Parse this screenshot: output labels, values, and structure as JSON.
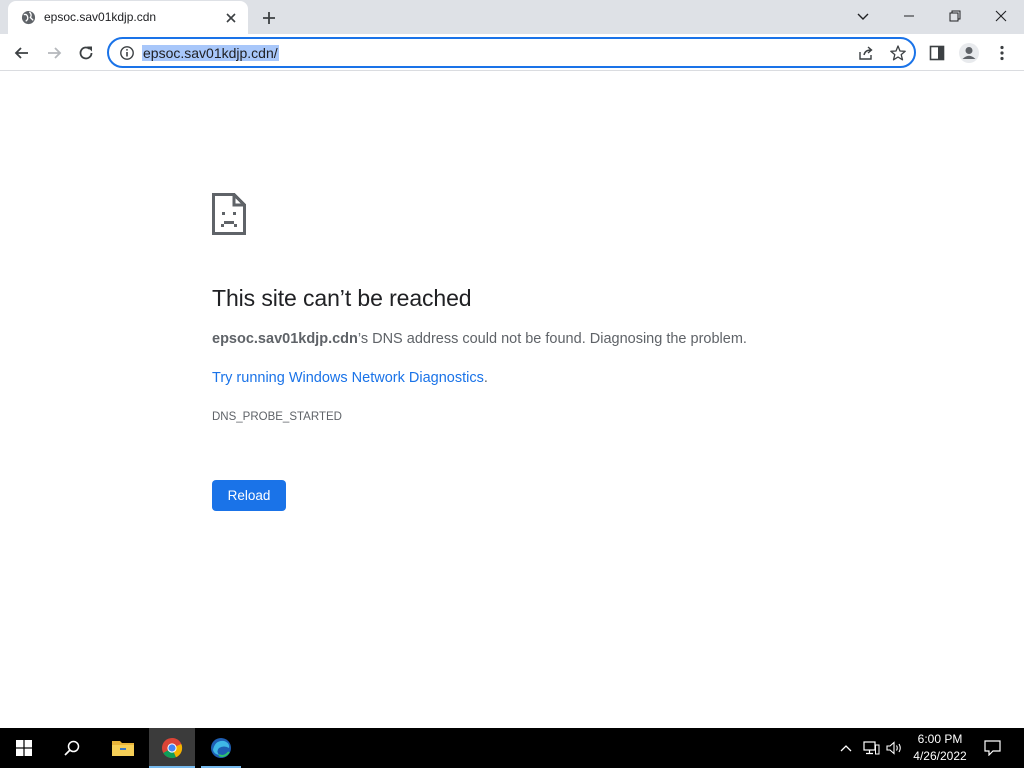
{
  "browser": {
    "tab": {
      "title": "epsoc.sav01kdjp.cdn",
      "favicon": "globe-icon"
    },
    "new_tab_icon": "plus-icon",
    "window_controls": [
      "chevron-down-icon",
      "minimize-icon",
      "restore-icon",
      "close-icon"
    ],
    "address_bar": {
      "url": "epsoc.sav01kdjp.cdn/",
      "url_selected": true,
      "accent": "#1a73e8",
      "selection_color": "#a8c7fa"
    }
  },
  "error_page": {
    "heading": "This site can’t be reached",
    "host": "epsoc.sav01kdjp.cdn",
    "message_suffix": "’s DNS address could not be found. Diagnosing the problem.",
    "link_text": "Try running Windows Network Diagnostics",
    "link_suffix": ".",
    "error_code": "DNS_PROBE_STARTED",
    "reload_label": "Reload",
    "button_color": "#1a73e8"
  },
  "taskbar": {
    "apps": [
      "windows-start-icon",
      "search-icon",
      "file-explorer-icon",
      "chrome-icon",
      "edge-icon"
    ],
    "active_app": "chrome-icon",
    "tray_icons": [
      "chevron-up-icon",
      "network-icon",
      "volume-icon",
      "notification-icon"
    ],
    "time": "6:00 PM",
    "date": "4/26/2022"
  }
}
